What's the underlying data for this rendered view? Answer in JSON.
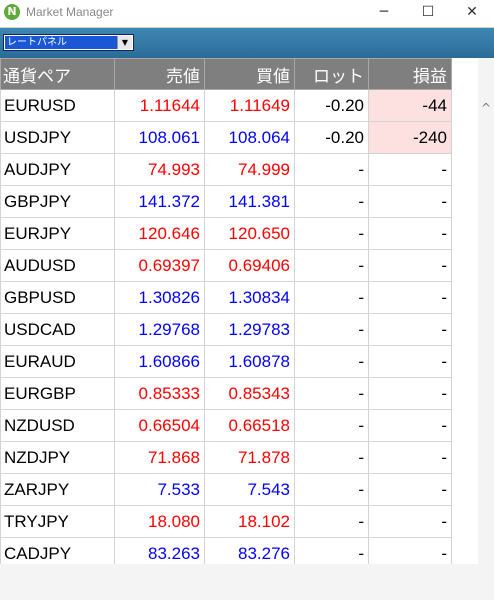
{
  "window": {
    "title": "Market Manager",
    "logo": "N",
    "minimize": "─",
    "maximize": "☐",
    "close": "✕"
  },
  "toolbar": {
    "panel_select": "レートパネル",
    "dropdown_arrow": "▼"
  },
  "scroll_up": "^",
  "colors": {
    "up": "#ff0000",
    "down": "#0000ff",
    "loss_bg": "#fde0e0",
    "header_bg": "#7f7f7f",
    "toolbar_bg": "#2b6c97"
  },
  "table": {
    "headers": {
      "pair": "通貨ペア",
      "bid": "売値",
      "ask": "買値",
      "lot": "ロット",
      "pl": "損益"
    },
    "rows": [
      {
        "pair": "EURUSD",
        "bid": "1.11644",
        "ask": "1.11649",
        "lot": "-0.20",
        "pl": "-44",
        "color": "up",
        "loss": true
      },
      {
        "pair": "USDJPY",
        "bid": "108.061",
        "ask": "108.064",
        "lot": "-0.20",
        "pl": "-240",
        "color": "down",
        "loss": true
      },
      {
        "pair": "AUDJPY",
        "bid": "74.993",
        "ask": "74.999",
        "lot": "-",
        "pl": "-",
        "color": "up",
        "loss": false
      },
      {
        "pair": "GBPJPY",
        "bid": "141.372",
        "ask": "141.381",
        "lot": "-",
        "pl": "-",
        "color": "down",
        "loss": false
      },
      {
        "pair": "EURJPY",
        "bid": "120.646",
        "ask": "120.650",
        "lot": "-",
        "pl": "-",
        "color": "up",
        "loss": false
      },
      {
        "pair": "AUDUSD",
        "bid": "0.69397",
        "ask": "0.69406",
        "lot": "-",
        "pl": "-",
        "color": "up",
        "loss": false
      },
      {
        "pair": "GBPUSD",
        "bid": "1.30826",
        "ask": "1.30834",
        "lot": "-",
        "pl": "-",
        "color": "down",
        "loss": false
      },
      {
        "pair": "USDCAD",
        "bid": "1.29768",
        "ask": "1.29783",
        "lot": "-",
        "pl": "-",
        "color": "down",
        "loss": false
      },
      {
        "pair": "EURAUD",
        "bid": "1.60866",
        "ask": "1.60878",
        "lot": "-",
        "pl": "-",
        "color": "down",
        "loss": false
      },
      {
        "pair": "EURGBP",
        "bid": "0.85333",
        "ask": "0.85343",
        "lot": "-",
        "pl": "-",
        "color": "up",
        "loss": false
      },
      {
        "pair": "NZDUSD",
        "bid": "0.66504",
        "ask": "0.66518",
        "lot": "-",
        "pl": "-",
        "color": "up",
        "loss": false
      },
      {
        "pair": "NZDJPY",
        "bid": "71.868",
        "ask": "71.878",
        "lot": "-",
        "pl": "-",
        "color": "up",
        "loss": false
      },
      {
        "pair": "ZARJPY",
        "bid": "7.533",
        "ask": "7.543",
        "lot": "-",
        "pl": "-",
        "color": "down",
        "loss": false
      },
      {
        "pair": "TRYJPY",
        "bid": "18.080",
        "ask": "18.102",
        "lot": "-",
        "pl": "-",
        "color": "up",
        "loss": false
      },
      {
        "pair": "CADJPY",
        "bid": "83.263",
        "ask": "83.276",
        "lot": "-",
        "pl": "-",
        "color": "down",
        "loss": false
      }
    ]
  }
}
